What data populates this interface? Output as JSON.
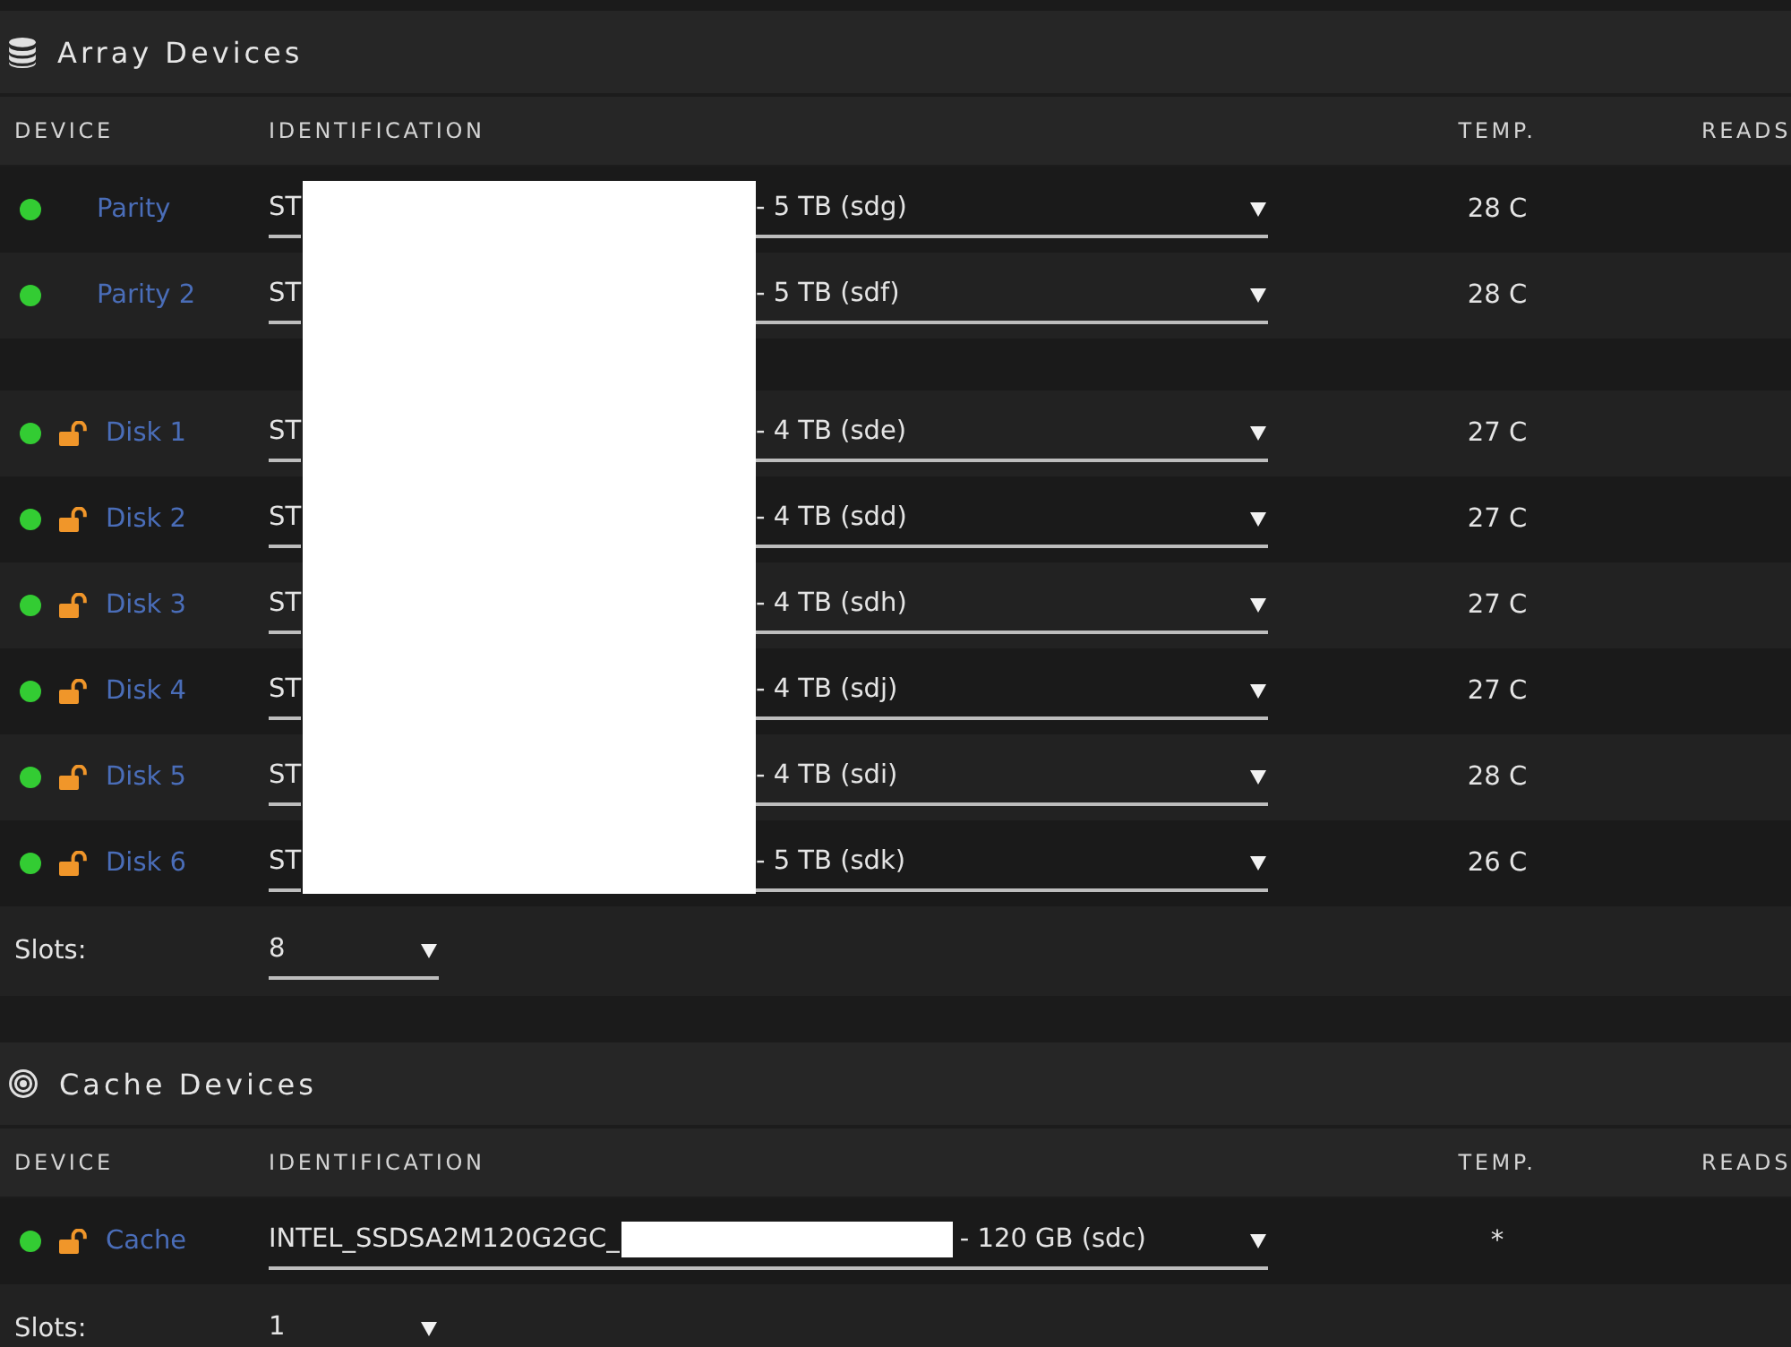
{
  "sections": [
    {
      "kind": "array",
      "title": "Array Devices",
      "columns": [
        "DEVICE",
        "IDENTIFICATION",
        "TEMP.",
        "READS"
      ],
      "row_groups": [
        [
          {
            "name": "Parity",
            "online": true,
            "identification_start": "ST",
            "identification_end": "- 5 TB (sdg)",
            "temp": "28 C"
          },
          {
            "name": "Parity 2",
            "online": true,
            "identification_start": "ST",
            "identification_end": "- 5 TB (sdf)",
            "temp": "28 C"
          }
        ],
        [
          {
            "name": "Disk 1",
            "online": true,
            "locked": false,
            "identification_start": "ST",
            "identification_end": "- 4 TB (sde)",
            "temp": "27 C"
          },
          {
            "name": "Disk 2",
            "online": true,
            "locked": false,
            "identification_start": "ST",
            "identification_end": "- 4 TB (sdd)",
            "temp": "27 C"
          },
          {
            "name": "Disk 3",
            "online": true,
            "locked": false,
            "identification_start": "ST",
            "identification_end": "- 4 TB (sdh)",
            "temp": "27 C"
          },
          {
            "name": "Disk 4",
            "online": true,
            "locked": false,
            "identification_start": "ST",
            "identification_end": "- 4 TB (sdj)",
            "temp": "27 C"
          },
          {
            "name": "Disk 5",
            "online": true,
            "locked": false,
            "identification_start": "ST",
            "identification_end": "- 4 TB (sdi)",
            "temp": "28 C"
          },
          {
            "name": "Disk 6",
            "online": true,
            "locked": false,
            "identification_start": "ST",
            "identification_end": "- 5 TB (sdk)",
            "temp": "26 C"
          }
        ]
      ],
      "slots": {
        "label": "Slots:",
        "value": "8"
      }
    },
    {
      "kind": "cache",
      "title": "Cache Devices",
      "columns": [
        "DEVICE",
        "IDENTIFICATION",
        "TEMP.",
        "READS"
      ],
      "row_groups": [
        [
          {
            "name": "Cache",
            "online": true,
            "locked": false,
            "identification_start": "INTEL_SSDSA2M120G2GC_",
            "identification_end": "- 120 GB (sdc)",
            "temp": "*"
          }
        ]
      ],
      "slots": {
        "label": "Slots:",
        "value": "1"
      }
    }
  ]
}
